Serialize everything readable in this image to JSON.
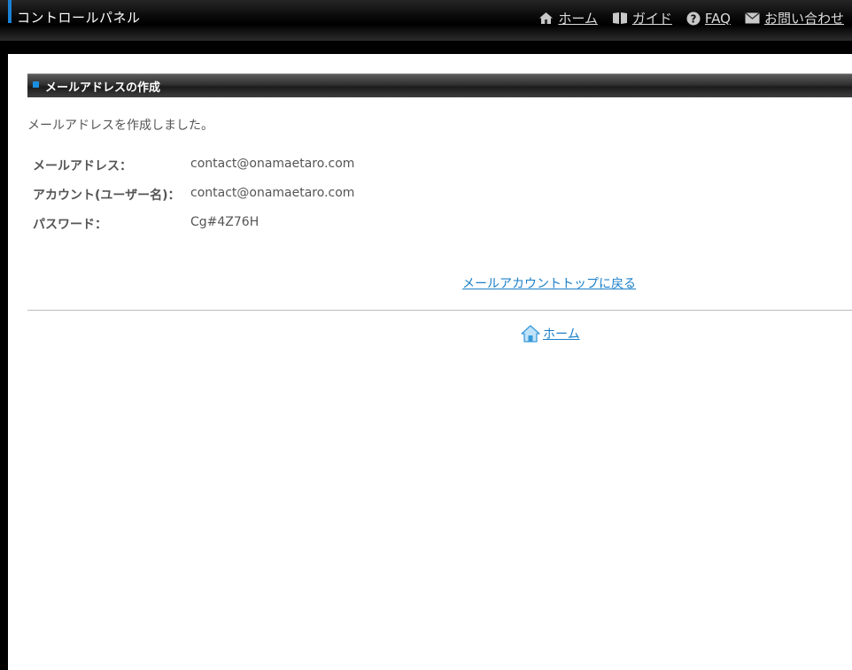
{
  "header": {
    "title": "コントロールパネル",
    "nav": [
      {
        "label": "ホーム",
        "icon": "home-icon"
      },
      {
        "label": "ガイド",
        "icon": "book-icon"
      },
      {
        "label": "FAQ",
        "icon": "question-icon"
      },
      {
        "label": "お問い合わせ",
        "icon": "mail-icon"
      }
    ]
  },
  "section": {
    "title": "メールアドレスの作成",
    "message": "メールアドレスを作成しました。"
  },
  "details": [
    {
      "label": "メールアドレス：",
      "value": "contact@onamaetaro.com"
    },
    {
      "label": "アカウント(ユーザー名)：",
      "value": "contact@onamaetaro.com"
    },
    {
      "label": "パスワード：",
      "value": "Cg#4Z76H"
    }
  ],
  "links": {
    "back": "メールアカウントトップに戻る",
    "home": "ホーム"
  },
  "colors": {
    "accent": "#1a82d6",
    "link": "#1a7fc9",
    "text": "#555555"
  }
}
